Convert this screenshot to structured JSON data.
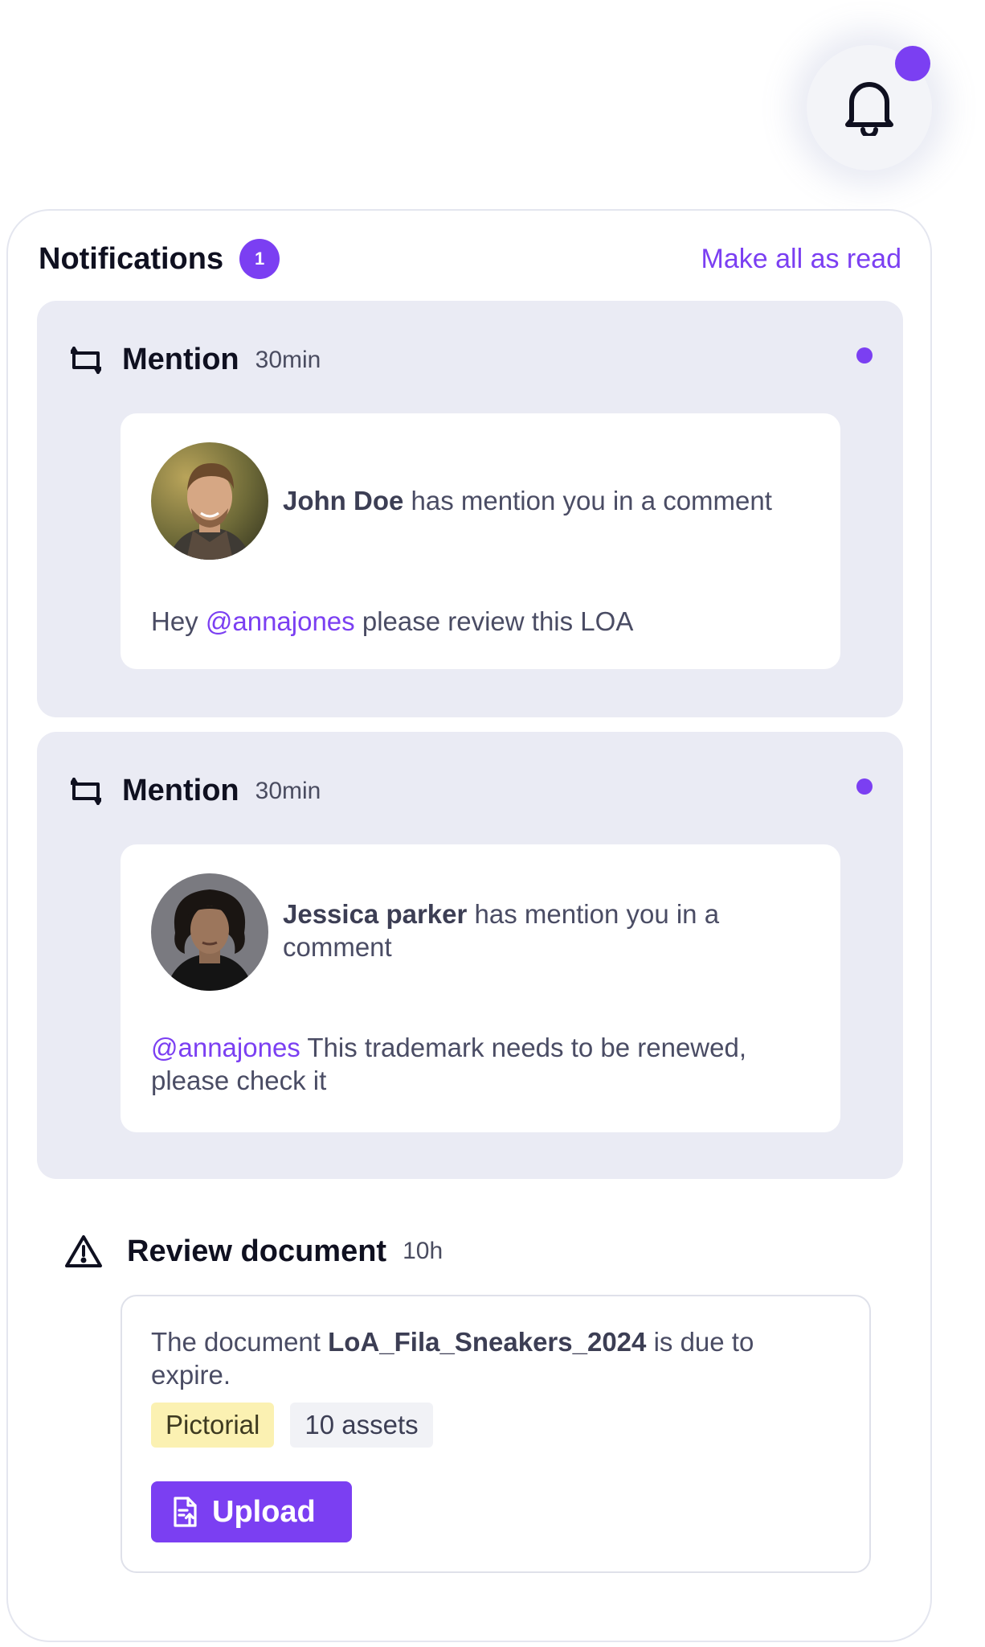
{
  "bell": {
    "icon": "bell-icon",
    "has_unread": true
  },
  "colors": {
    "accent": "#7b3ff2",
    "card_bg": "#eaebf4",
    "tag_yellow": "#fbf1b2"
  },
  "panel": {
    "title": "Notifications",
    "count": "1",
    "mark_all_read": "Make all as read"
  },
  "notifications": [
    {
      "type": "Mention",
      "time": "30min",
      "icon": "mention-icon",
      "unread": true,
      "author": "John Doe",
      "action": "has mention you in a comment",
      "mention": "@annajones",
      "comment_before": "Hey",
      "comment_after": "please review this LOA"
    },
    {
      "type": "Mention",
      "time": "30min",
      "icon": "mention-icon",
      "unread": true,
      "author": "Jessica parker",
      "action": "has mention you in a comment",
      "mention": "@annajones",
      "comment_after": "This trademark needs to be renewed, please check it"
    }
  ],
  "review": {
    "type": "Review document",
    "time": "10h",
    "icon": "warning-icon",
    "text_before": "The document",
    "document_name": "LoA_Fila_Sneakers_2024",
    "text_after": "is due to expire.",
    "tags": [
      "Pictorial",
      "10 assets"
    ],
    "button_label": "Upload",
    "button_icon": "document-upload-icon"
  }
}
